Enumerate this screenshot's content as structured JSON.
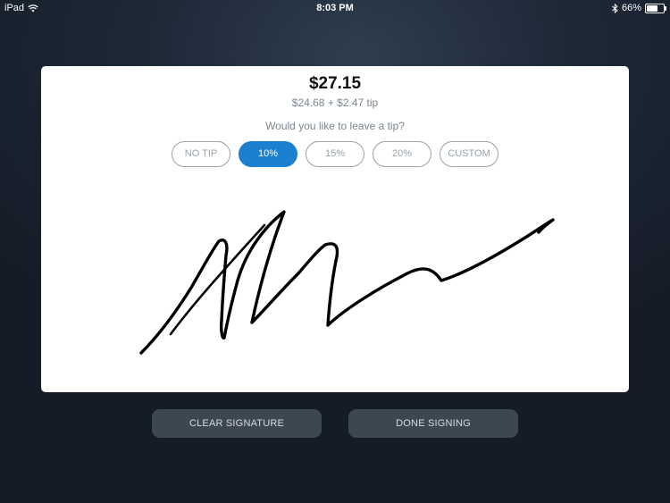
{
  "status_bar": {
    "device": "iPad",
    "time": "8:03 PM",
    "battery_percent": "66%",
    "battery_level": 0.66,
    "icons": [
      "wifi-icon",
      "bluetooth-icon",
      "battery-icon"
    ]
  },
  "payment": {
    "total": "$27.15",
    "breakdown": "$24.68 + $2.47 tip",
    "tip_prompt": "Would you like to leave a tip?"
  },
  "tip_options": [
    {
      "label": "NO TIP",
      "selected": false
    },
    {
      "label": "10%",
      "selected": true
    },
    {
      "label": "15%",
      "selected": false
    },
    {
      "label": "20%",
      "selected": false
    },
    {
      "label": "CUSTOM",
      "selected": false
    }
  ],
  "actions": {
    "clear_label": "CLEAR SIGNATURE",
    "done_label": "DONE SIGNING"
  },
  "colors": {
    "accent": "#1b80d0",
    "signature_ink": "#000000"
  }
}
